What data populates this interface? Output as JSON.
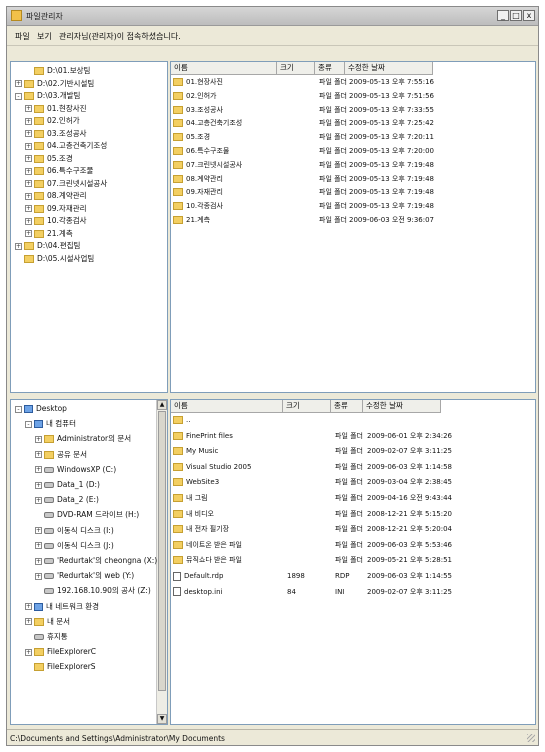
{
  "window": {
    "title": "파일관리자",
    "controls": [
      "_",
      "□",
      "x"
    ]
  },
  "menu": [
    "파일",
    "보기",
    "관리자님(관리자)이 접속하셨습니다."
  ],
  "top_tree": [
    {
      "label": "D:\\01.보상팀",
      "indent": 1,
      "exp": ""
    },
    {
      "label": "D:\\02.기반시설팀",
      "indent": 0,
      "exp": "+"
    },
    {
      "label": "D:\\03.개발팀",
      "indent": 0,
      "exp": "-"
    },
    {
      "label": "01.현장사진",
      "indent": 1,
      "exp": "+"
    },
    {
      "label": "02.인허가",
      "indent": 1,
      "exp": "+"
    },
    {
      "label": "03.조성공사",
      "indent": 1,
      "exp": "+"
    },
    {
      "label": "04.고층건축기조성",
      "indent": 1,
      "exp": "+"
    },
    {
      "label": "05.조경",
      "indent": 1,
      "exp": "+"
    },
    {
      "label": "06.특수구조물",
      "indent": 1,
      "exp": "+"
    },
    {
      "label": "07.크린넷시설공사",
      "indent": 1,
      "exp": "+"
    },
    {
      "label": "08.계약관리",
      "indent": 1,
      "exp": "+"
    },
    {
      "label": "09.자재관리",
      "indent": 1,
      "exp": "+"
    },
    {
      "label": "10.각종검사",
      "indent": 1,
      "exp": "+"
    },
    {
      "label": "21.계측",
      "indent": 1,
      "exp": "+"
    },
    {
      "label": "D:\\04.편집팀",
      "indent": 0,
      "exp": "+"
    },
    {
      "label": "D:\\05.시설사업팀",
      "indent": 0,
      "exp": ""
    }
  ],
  "top_list": {
    "headers": [
      "이름",
      "크기",
      "종류",
      "수정한 날짜"
    ],
    "rows": [
      {
        "name": "01.현장사진",
        "size": "",
        "type": "파일 폴더",
        "date": "2009-05-13 오후 7:55:16"
      },
      {
        "name": "02.인허가",
        "size": "",
        "type": "파일 폴더",
        "date": "2009-05-13 오후 7:51:56"
      },
      {
        "name": "03.조성공사",
        "size": "",
        "type": "파일 폴더",
        "date": "2009-05-13 오후 7:33:55"
      },
      {
        "name": "04.고층건축기조성",
        "size": "",
        "type": "파일 폴더",
        "date": "2009-05-13 오후 7:25:42"
      },
      {
        "name": "05.조경",
        "size": "",
        "type": "파일 폴더",
        "date": "2009-05-13 오후 7:20:11"
      },
      {
        "name": "06.특수구조물",
        "size": "",
        "type": "파일 폴더",
        "date": "2009-05-13 오후 7:20:00"
      },
      {
        "name": "07.크린넷시설공사",
        "size": "",
        "type": "파일 폴더",
        "date": "2009-05-13 오후 7:19:48"
      },
      {
        "name": "08.계약관리",
        "size": "",
        "type": "파일 폴더",
        "date": "2009-05-13 오후 7:19:48"
      },
      {
        "name": "09.자재관리",
        "size": "",
        "type": "파일 폴더",
        "date": "2009-05-13 오후 7:19:48"
      },
      {
        "name": "10.각종검사",
        "size": "",
        "type": "파일 폴더",
        "date": "2009-05-13 오후 7:19:48"
      },
      {
        "name": "21.계측",
        "size": "",
        "type": "파일 폴더",
        "date": "2009-06-03 오전 9:36:07"
      }
    ]
  },
  "bottom_tree": [
    {
      "label": "Desktop",
      "indent": 0,
      "exp": "-",
      "icon": "pc"
    },
    {
      "label": "내 컴퓨터",
      "indent": 1,
      "exp": "-",
      "icon": "pc"
    },
    {
      "label": "Administrator의 문서",
      "indent": 2,
      "exp": "+",
      "icon": "folder"
    },
    {
      "label": "공유 문서",
      "indent": 2,
      "exp": "+",
      "icon": "folder"
    },
    {
      "label": "WindowsXP (C:)",
      "indent": 2,
      "exp": "+",
      "icon": "drive"
    },
    {
      "label": "Data_1 (D:)",
      "indent": 2,
      "exp": "+",
      "icon": "drive"
    },
    {
      "label": "Data_2 (E:)",
      "indent": 2,
      "exp": "+",
      "icon": "drive"
    },
    {
      "label": "DVD-RAM 드라이브 (H:)",
      "indent": 2,
      "exp": "",
      "icon": "drive"
    },
    {
      "label": "이동식 디스크 (I:)",
      "indent": 2,
      "exp": "+",
      "icon": "drive"
    },
    {
      "label": "이동식 디스크 (J:)",
      "indent": 2,
      "exp": "+",
      "icon": "drive"
    },
    {
      "label": "'Redurtak'의 cheongna (X:)",
      "indent": 2,
      "exp": "+",
      "icon": "drive"
    },
    {
      "label": "'Redurtak'의 web (Y:)",
      "indent": 2,
      "exp": "+",
      "icon": "drive"
    },
    {
      "label": "192.168.10.90의 공사 (Z:)",
      "indent": 2,
      "exp": "",
      "icon": "drive"
    },
    {
      "label": "내 네트워크 환경",
      "indent": 1,
      "exp": "+",
      "icon": "pc"
    },
    {
      "label": "내 문서",
      "indent": 1,
      "exp": "+",
      "icon": "folder"
    },
    {
      "label": "휴지통",
      "indent": 1,
      "exp": "",
      "icon": "drive"
    },
    {
      "label": "FileExplorerC",
      "indent": 1,
      "exp": "+",
      "icon": "folder"
    },
    {
      "label": "FileExplorerS",
      "indent": 1,
      "exp": "",
      "icon": "folder"
    }
  ],
  "bottom_list": {
    "headers": [
      "이름",
      "크기",
      "종류",
      "수정한 날짜"
    ],
    "rows": [
      {
        "name": "..",
        "size": "",
        "type": "",
        "date": "",
        "icon": "folder"
      },
      {
        "name": "FinePrint files",
        "size": "",
        "type": "파일 폴더",
        "date": "2009-06-01 오후 2:34:26",
        "icon": "folder"
      },
      {
        "name": "My Music",
        "size": "",
        "type": "파일 폴더",
        "date": "2009-02-07 오후 3:11:25",
        "icon": "folder"
      },
      {
        "name": "Visual Studio 2005",
        "size": "",
        "type": "파일 폴더",
        "date": "2009-06-03 오후 1:14:58",
        "icon": "folder"
      },
      {
        "name": "WebSite3",
        "size": "",
        "type": "파일 폴더",
        "date": "2009-03-04 오후 2:38:45",
        "icon": "folder"
      },
      {
        "name": "내 그림",
        "size": "",
        "type": "파일 폴더",
        "date": "2009-04-16 오전 9:43:44",
        "icon": "folder"
      },
      {
        "name": "내 비디오",
        "size": "",
        "type": "파일 폴더",
        "date": "2008-12-21 오후 5:15:20",
        "icon": "folder"
      },
      {
        "name": "내 전자 필기장",
        "size": "",
        "type": "파일 폴더",
        "date": "2008-12-21 오후 5:20:04",
        "icon": "folder"
      },
      {
        "name": "네이트온 받은 파일",
        "size": "",
        "type": "파일 폴더",
        "date": "2009-06-03 오후 5:53:46",
        "icon": "folder"
      },
      {
        "name": "뮤직쇼다 받은 파일",
        "size": "",
        "type": "파일 폴더",
        "date": "2009-05-21 오후 5:28:51",
        "icon": "folder"
      },
      {
        "name": "Default.rdp",
        "size": "1898",
        "type": "RDP",
        "date": "2009-06-03 오후 1:14:55",
        "icon": "file"
      },
      {
        "name": "desktop.ini",
        "size": "84",
        "type": "INI",
        "date": "2009-02-07 오후 3:11:25",
        "icon": "file"
      }
    ]
  },
  "status": "C:\\Documents and Settings\\Administrator\\My Documents"
}
